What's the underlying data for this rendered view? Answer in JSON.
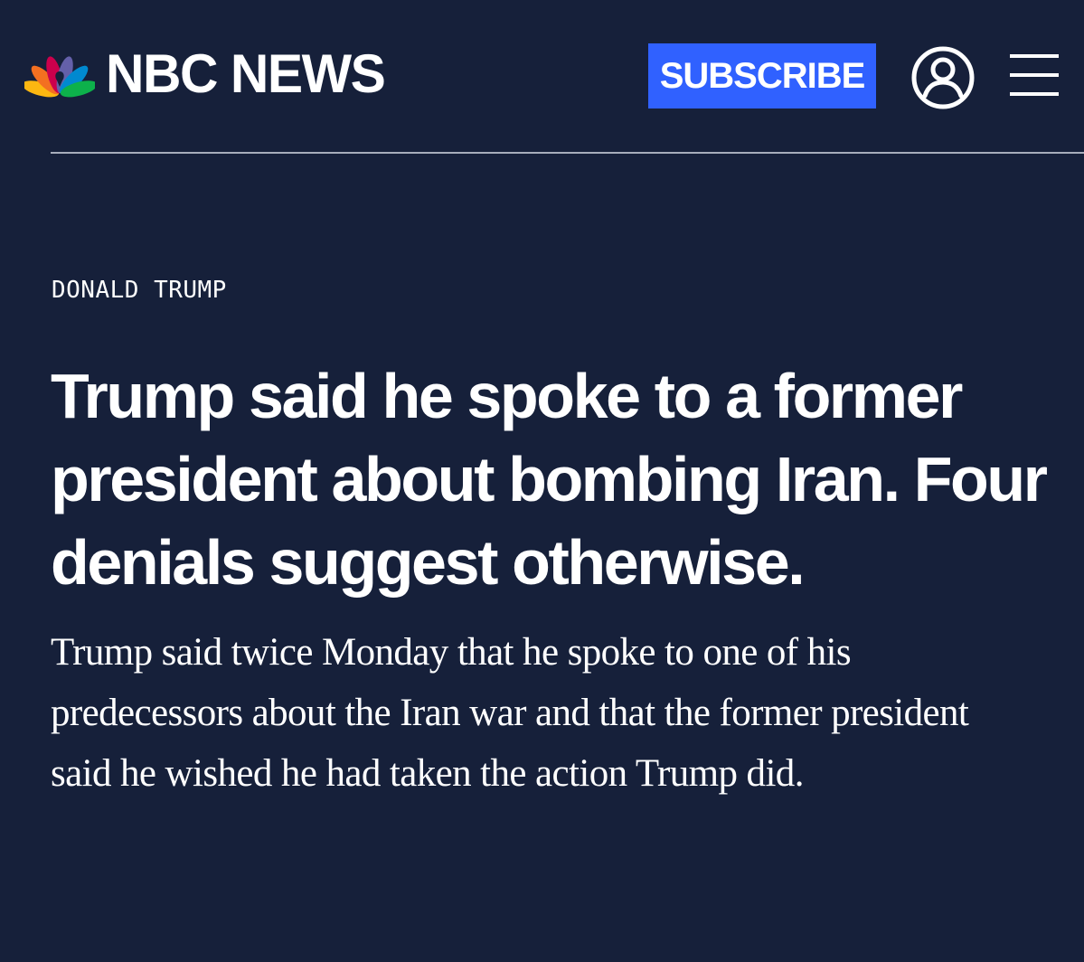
{
  "header": {
    "logo_text": "NBC NEWS",
    "subscribe_label": "SUBSCRIBE",
    "account_icon": "user-circle-icon",
    "menu_icon": "hamburger-menu-icon"
  },
  "article": {
    "category": "DONALD TRUMP",
    "headline": "Trump said he spoke to a former president about bombing Iran. Four denials suggest otherwise.",
    "dek": "Trump said twice Monday that he spoke to one of his predecessors about the Iran war and that the former president said he wished he had taken the action Trump did."
  },
  "colors": {
    "background": "#16203a",
    "subscribe": "#3061ff",
    "text": "#ffffff",
    "divider": "#a7adbb",
    "peacock_yellow": "#fcb711",
    "peacock_orange": "#f37021",
    "peacock_red": "#cc004c",
    "peacock_purple": "#6460aa",
    "peacock_blue": "#0089d0",
    "peacock_green": "#0db14b"
  }
}
